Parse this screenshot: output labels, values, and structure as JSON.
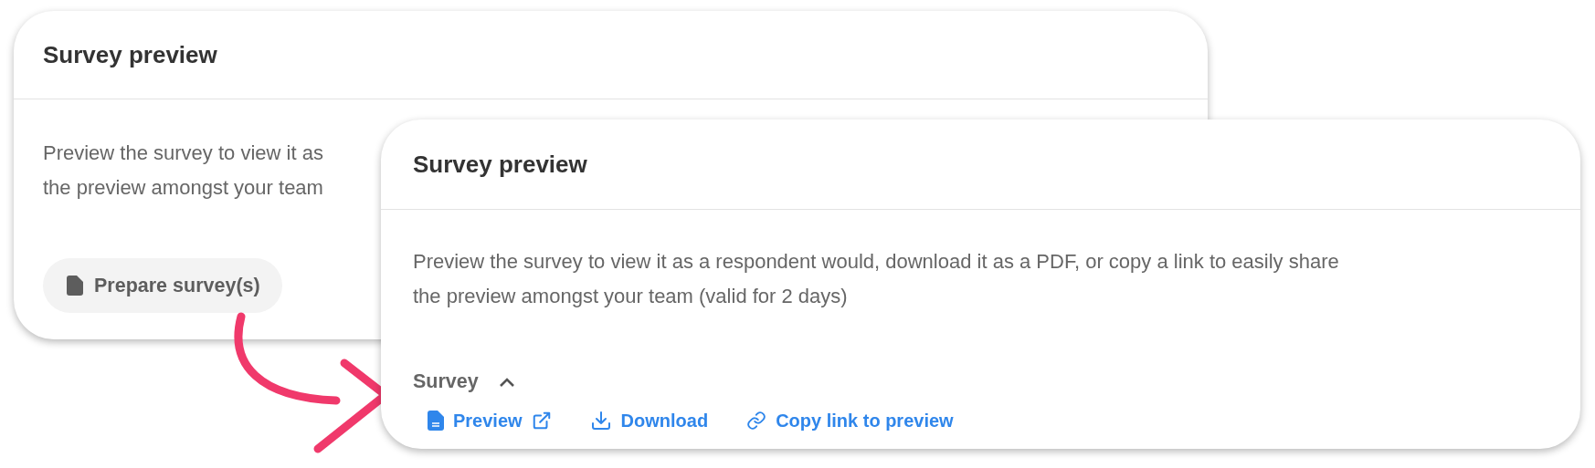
{
  "back_card": {
    "title": "Survey preview",
    "body_lines": [
      "Preview the survey to view it as",
      "the preview amongst your team"
    ],
    "button": "Prepare survey(s)"
  },
  "front_card": {
    "title": "Survey preview",
    "body_lines": [
      "Preview the survey to view it as a respondent would, download it as a PDF, or copy a link to easily share",
      "the preview amongst your team (valid for 2 days)"
    ],
    "section": {
      "label": "Survey",
      "expanded": true
    },
    "links": [
      {
        "kind": "preview",
        "label": "Preview"
      },
      {
        "kind": "download",
        "label": "Download"
      },
      {
        "kind": "copy",
        "label": "Copy link to preview"
      }
    ]
  }
}
